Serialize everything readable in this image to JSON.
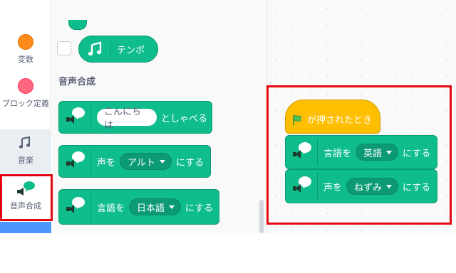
{
  "categories": [
    {
      "label": "変数",
      "color": "#ff8c1a"
    },
    {
      "label": "ブロック定義",
      "color": "#ff6680"
    },
    {
      "label": "音楽",
      "icon": "music-notes-icon"
    },
    {
      "label": "音声合成",
      "icon": "speech-bubble-speaker-icon"
    }
  ],
  "palette": {
    "music_block_label": "テンポ",
    "section_title": "音声合成",
    "speak_block": {
      "input": "こんにちは",
      "suffix": "としゃべる"
    },
    "voice_block": {
      "prefix": "声を",
      "value": "アルト",
      "suffix": "にする"
    },
    "language_block": {
      "prefix": "言語を",
      "value": "日本語",
      "suffix": "にする"
    }
  },
  "script": {
    "hat_label": "が押されたとき",
    "language_block": {
      "prefix": "言語を",
      "value": "英語",
      "suffix": "にする"
    },
    "voice_block": {
      "prefix": "声を",
      "value": "ねずみ",
      "suffix": "にする"
    }
  },
  "colors": {
    "tts_green": "#0fbd8c",
    "event_yellow": "#ffbf00",
    "highlight_red": "#e30613",
    "variables_orange": "#ff8c1a",
    "my_blocks_pink": "#ff6680"
  }
}
